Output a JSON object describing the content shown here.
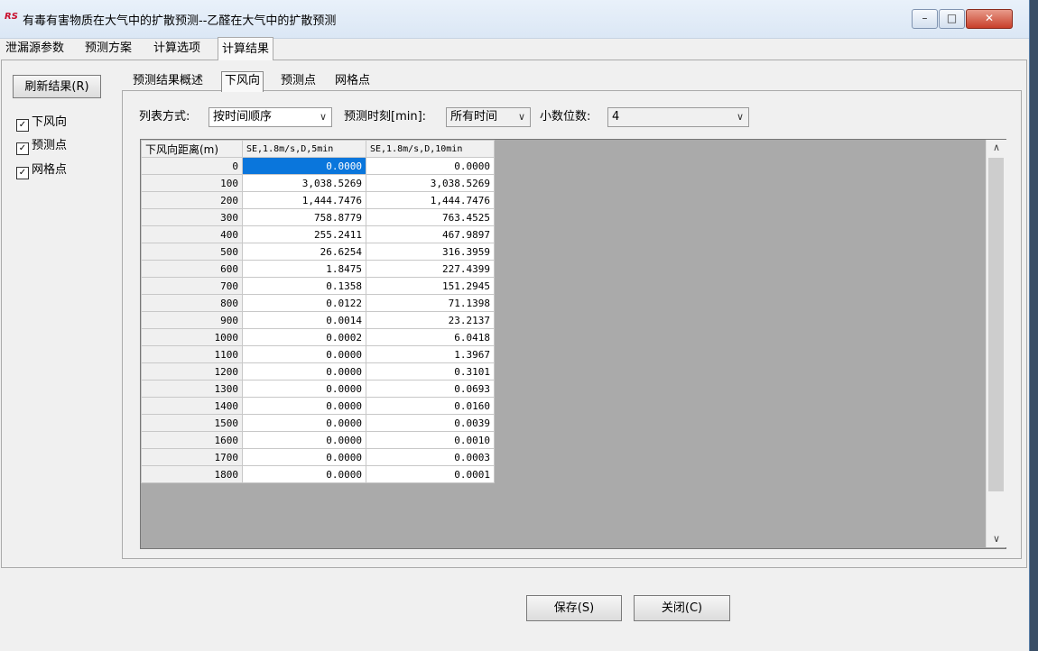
{
  "window": {
    "logo_text": "RS",
    "title": "有毒有害物质在大气中的扩散预测--乙醛在大气中的扩散预测",
    "min_glyph": "–",
    "max_glyph": "□",
    "close_glyph": "✕"
  },
  "main_tabs": [
    "泄漏源参数",
    "预测方案",
    "计算选项",
    "计算结果"
  ],
  "left_panel": {
    "refresh_label": "刷新结果(R)",
    "check_mark": "✓",
    "checkboxes": [
      "下风向",
      "预测点",
      "网格点"
    ]
  },
  "sub_tabs": [
    "预测结果概述",
    "下风向",
    "预测点",
    "网格点"
  ],
  "filters": {
    "list_mode_label": "列表方式:",
    "list_mode_value": "按时间顺序",
    "time_label": "预测时刻[min]:",
    "time_value": "所有时间",
    "decimals_label": "小数位数:",
    "decimals_value": "4",
    "arrow": "∨"
  },
  "grid": {
    "headers": [
      "下风向距离(m)",
      "SE,1.8m/s,D,5min",
      "SE,1.8m/s,D,10min"
    ],
    "rows": [
      [
        "0",
        "0.0000",
        "0.0000"
      ],
      [
        "100",
        "3,038.5269",
        "3,038.5269"
      ],
      [
        "200",
        "1,444.7476",
        "1,444.7476"
      ],
      [
        "300",
        "758.8779",
        "763.4525"
      ],
      [
        "400",
        "255.2411",
        "467.9897"
      ],
      [
        "500",
        "26.6254",
        "316.3959"
      ],
      [
        "600",
        "1.8475",
        "227.4399"
      ],
      [
        "700",
        "0.1358",
        "151.2945"
      ],
      [
        "800",
        "0.0122",
        "71.1398"
      ],
      [
        "900",
        "0.0014",
        "23.2137"
      ],
      [
        "1000",
        "0.0002",
        "6.0418"
      ],
      [
        "1100",
        "0.0000",
        "1.3967"
      ],
      [
        "1200",
        "0.0000",
        "0.3101"
      ],
      [
        "1300",
        "0.0000",
        "0.0693"
      ],
      [
        "1400",
        "0.0000",
        "0.0160"
      ],
      [
        "1500",
        "0.0000",
        "0.0039"
      ],
      [
        "1600",
        "0.0000",
        "0.0010"
      ],
      [
        "1700",
        "0.0000",
        "0.0003"
      ],
      [
        "1800",
        "0.0000",
        "0.0001"
      ]
    ],
    "scroll_up": "∧",
    "scroll_down": "∨"
  },
  "buttons": {
    "save": "保存(S)",
    "close": "关闭(C)"
  }
}
